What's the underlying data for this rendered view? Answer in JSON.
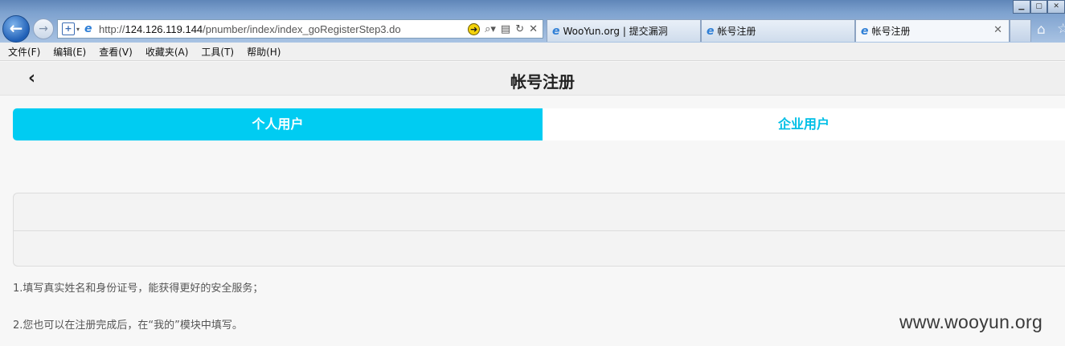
{
  "browser": {
    "url_prefix": "http://",
    "url_host": "124.126.119.144",
    "url_path": "/pnumber/index/index_goRegisterStep3.do",
    "tabs": [
      {
        "label": "WooYun.org | 提交漏洞"
      },
      {
        "label": "帐号注册"
      },
      {
        "label": "帐号注册"
      }
    ],
    "menu": [
      "文件(F)",
      "编辑(E)",
      "查看(V)",
      "收藏夹(A)",
      "工具(T)",
      "帮助(H)"
    ]
  },
  "page": {
    "title": "帐号注册",
    "back_icon": "‹",
    "segments": {
      "personal": "个人用户",
      "enterprise": "企业用户"
    },
    "form": {
      "name_value": "",
      "id_value": ""
    },
    "notes": [
      "1.填写真实姓名和身份证号，能获得更好的安全服务；",
      "2.您也可以在注册完成后，在“我的”模块中填写。"
    ]
  },
  "watermark": "www.wooyun.org",
  "colors": {
    "accent": "#00ccf2",
    "accent_text": "#00bfe6"
  }
}
